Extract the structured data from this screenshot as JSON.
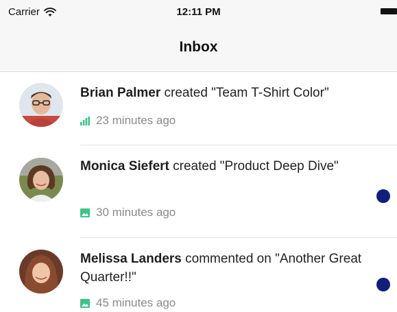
{
  "status_bar": {
    "carrier": "Carrier",
    "time": "12:11 PM",
    "wifi_icon": "wifi-icon",
    "battery_icon": "battery-icon"
  },
  "nav": {
    "title": "Inbox"
  },
  "colors": {
    "unread_dot": "#0f1f7a",
    "meta_icon": "#3cc48a",
    "meta_text": "#8a8a8a"
  },
  "notifications": [
    {
      "name": "Brian Palmer",
      "action": "created \"Team T-Shirt Color\"",
      "time": "23 minutes ago",
      "icon": "bar-chart-icon",
      "unread": false
    },
    {
      "name": "Monica Siefert",
      "action": "created \"Product Deep Dive\"",
      "time": "30 minutes ago",
      "icon": "image-icon",
      "unread": true
    },
    {
      "name": "Melissa Landers",
      "action": "commented on \"Another Great Quarter!!\"",
      "time": "45 minutes ago",
      "icon": "image-icon",
      "unread": true
    }
  ]
}
